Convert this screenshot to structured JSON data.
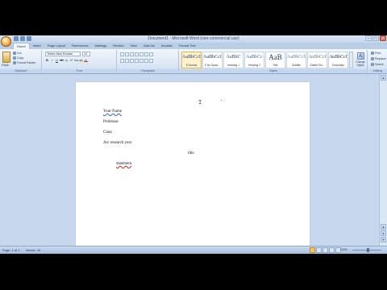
{
  "window": {
    "title": "Document1 - Microsoft Word (non-commercial use)"
  },
  "ribbon": {
    "tabs": [
      "Home",
      "Insert",
      "Page Layout",
      "References",
      "Mailings",
      "Review",
      "View",
      "Add-Ins",
      "Acrobat",
      "Format Text"
    ],
    "active_tab": "Home",
    "clipboard": {
      "paste_label": "Paste",
      "cut_label": "Cut",
      "copy_label": "Copy",
      "format_painter_label": "Format Painter",
      "group_label": "Clipboard"
    },
    "font": {
      "font_name": "Times New Roman",
      "font_size": "12",
      "group_label": "Font"
    },
    "paragraph": {
      "group_label": "Paragraph"
    },
    "styles": {
      "items": [
        {
          "sample": "AaBbCcI",
          "name": "¶ Normal"
        },
        {
          "sample": "AaBbCcI",
          "name": "¶ No Spaci..."
        },
        {
          "sample": "AaBbC",
          "name": "Heading 1"
        },
        {
          "sample": "AaBbCc",
          "name": "Heading 2"
        },
        {
          "sample": "AaB",
          "name": "Title"
        },
        {
          "sample": "AaBbCcI",
          "name": "Subtitle"
        },
        {
          "sample": "AaBbCcI",
          "name": "Subtle Em..."
        },
        {
          "sample": "AaBbCcI",
          "name": "Emphasis"
        }
      ],
      "active_index": 0,
      "change_styles_label": "Change Styles",
      "group_label": "Styles"
    },
    "editing": {
      "find_label": "Find",
      "replace_label": "Replace",
      "select_label": "Select",
      "group_label": "Editing"
    }
  },
  "document": {
    "lines": [
      "Your Name",
      "Professor",
      "Class",
      "Arc research year",
      "title",
      "statement"
    ]
  },
  "status": {
    "page": "Page: 1 of 1",
    "words": "Words: 15",
    "zoom": "100%"
  },
  "colors": {
    "ribbon_bg": "#dbe6f4",
    "accent": "#f5c46c",
    "workspace": "#c7d7ee"
  },
  "icons": {
    "office_button": "office-logo-icon",
    "close": "close-icon"
  }
}
